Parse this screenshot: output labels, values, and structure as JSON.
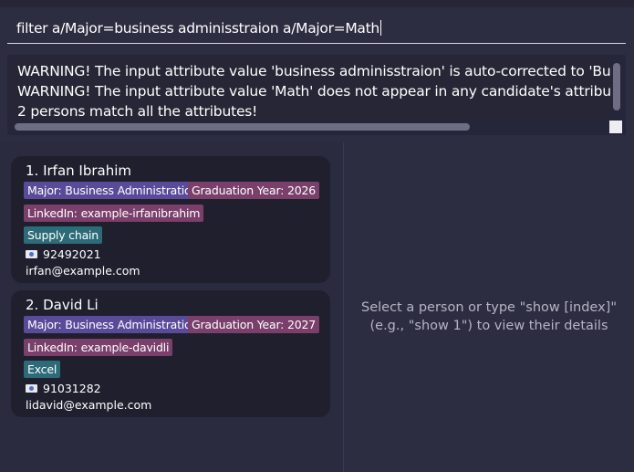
{
  "command": {
    "value": "filter a/Major=business adminisstraion a/Major=Math"
  },
  "result": {
    "lines": [
      "WARNING! The input attribute value 'business adminisstraion' is auto-corrected to 'Business Administration'",
      "WARNING! The input attribute value 'Math' does not appear in any candidate's attributes. I",
      "2 persons match all the attributes!"
    ]
  },
  "persons": [
    {
      "name": "1. Irfan Ibrahim",
      "major": "Major: Business Administration",
      "graduation": "Graduation Year: 2026",
      "linkedin": "LinkedIn: example-irfanibrahim",
      "skill": "Supply chain",
      "phone": "92492021",
      "email": "irfan@example.com"
    },
    {
      "name": "2. David Li",
      "major": "Major: Business Administration",
      "graduation": "Graduation Year: 2027",
      "linkedin": "LinkedIn: example-davidli",
      "skill": "Excel",
      "phone": "91031282",
      "email": "lidavid@example.com"
    }
  ],
  "detail": {
    "placeholder_line1": "Select a person or type \"show [index]\"",
    "placeholder_line2": "(e.g., \"show 1\") to view their details"
  },
  "icons": {
    "phone": "phone-icon"
  },
  "colors": {
    "background": "#2d2d41",
    "card": "#1f1f2e",
    "major_tag": "#5a4a9a",
    "graduation_tag": "#7a3f6b",
    "skill_tag": "#2d6b78"
  }
}
